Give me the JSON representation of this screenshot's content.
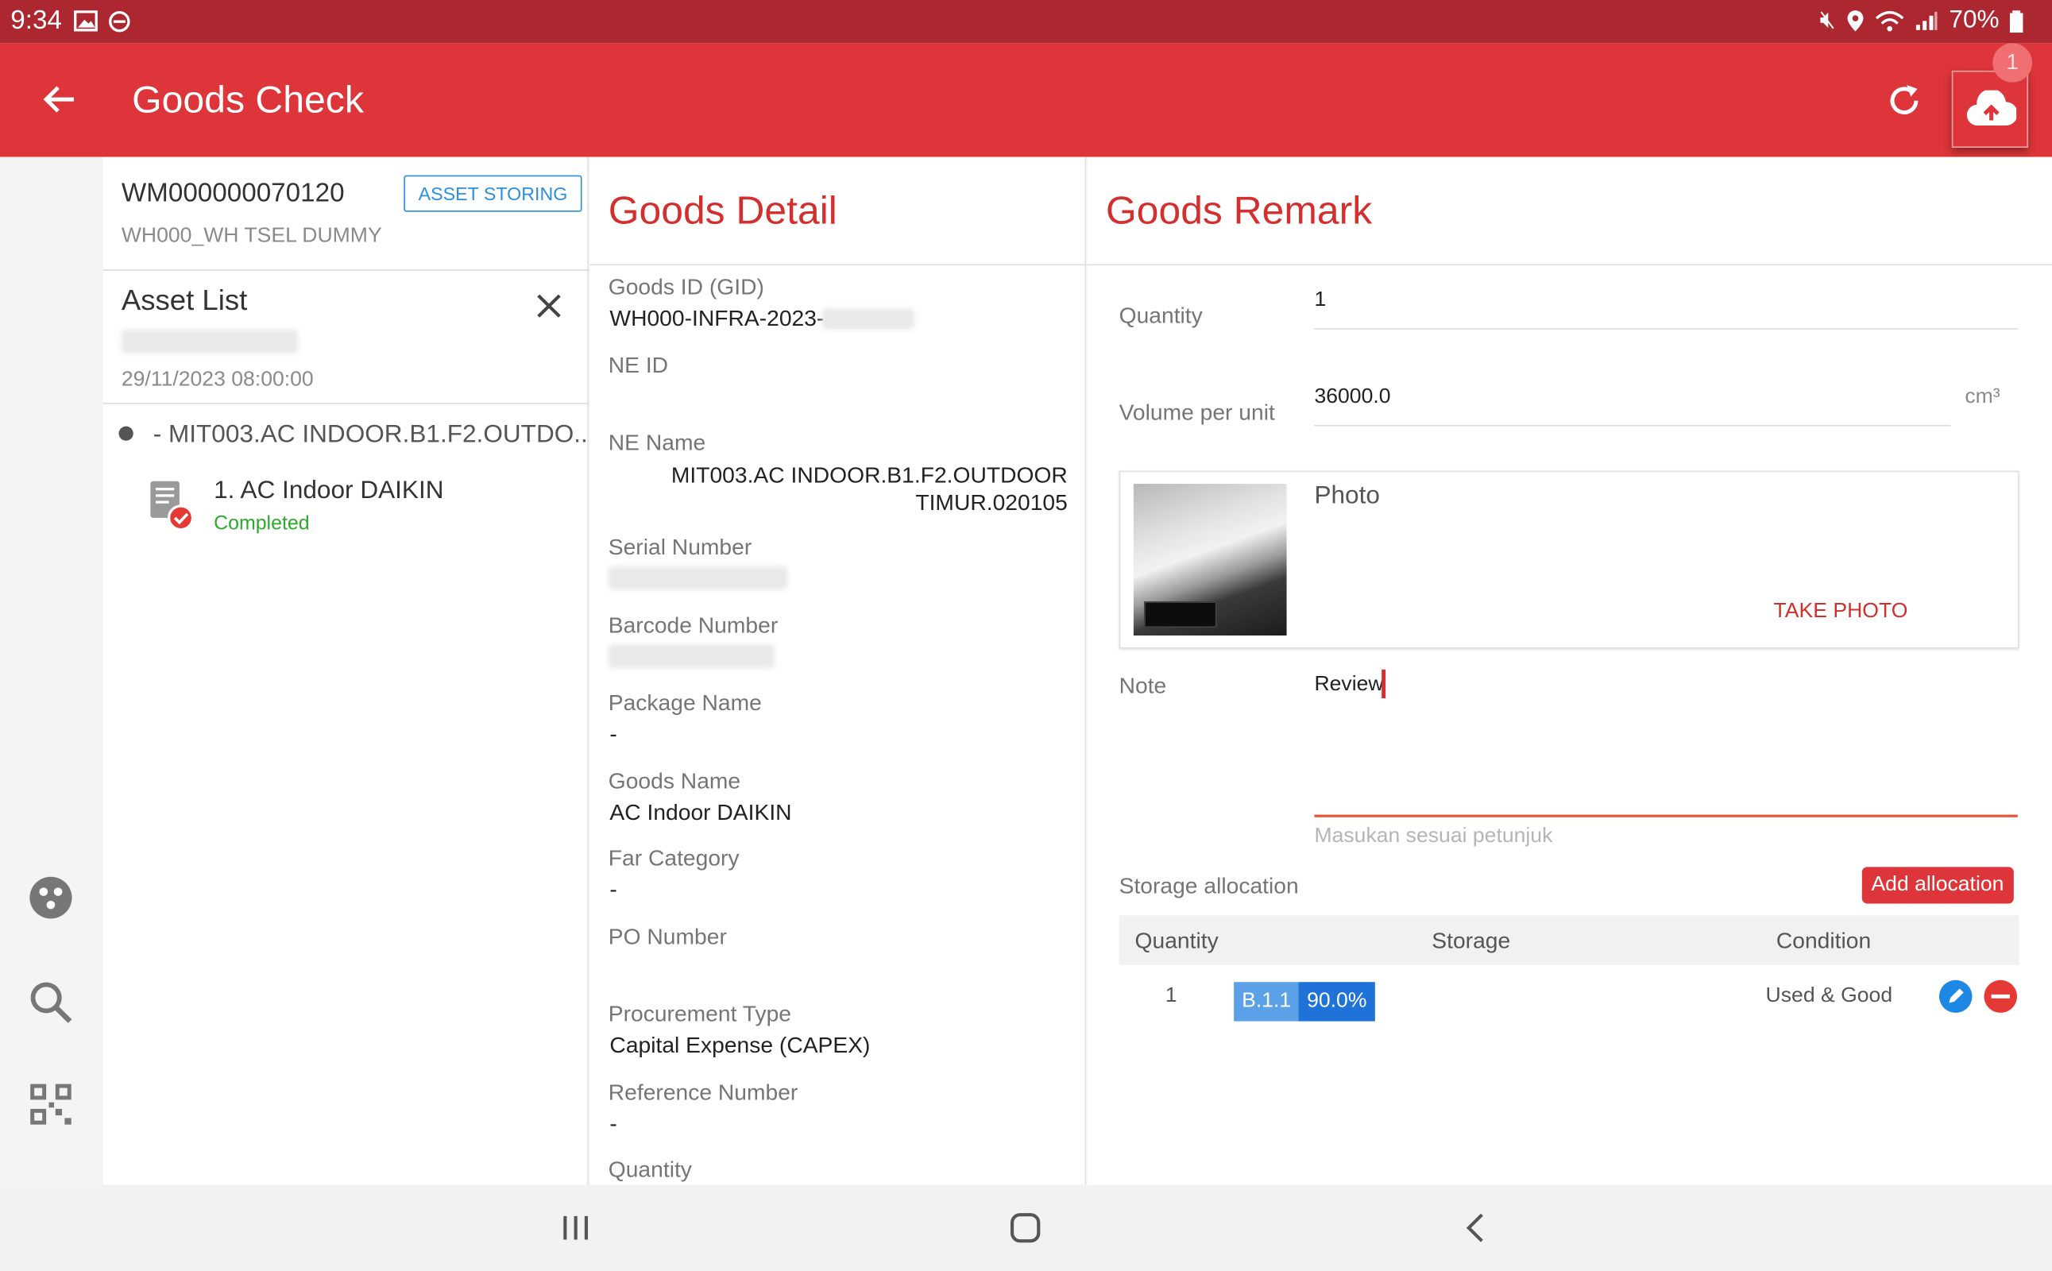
{
  "status_bar": {
    "time": "9:34",
    "battery": "70%"
  },
  "app_bar": {
    "title": "Goods Check",
    "upload_count": "1"
  },
  "order": {
    "id": "WM000000070120",
    "tag": "ASSET STORING",
    "warehouse": "WH000_WH TSEL DUMMY"
  },
  "asset_list": {
    "title": "Asset List",
    "date": "29/11/2023 08:00:00",
    "group": "- MIT003.AC INDOOR.B1.F2.OUTDO...",
    "items": [
      {
        "name": "1. AC Indoor DAIKIN",
        "status": "Completed"
      }
    ]
  },
  "goods_detail": {
    "title": "Goods Detail",
    "fields": [
      {
        "label": "Goods ID (GID)",
        "value": "WH000-INFRA-2023-"
      },
      {
        "label": "NE ID",
        "value": ""
      },
      {
        "label": "NE Name",
        "value": "MIT003.AC INDOOR.B1.F2.OUTDOOR TIMUR.020105"
      },
      {
        "label": "Serial Number",
        "value": ""
      },
      {
        "label": "Barcode Number",
        "value": ""
      },
      {
        "label": "Package Name",
        "value": "-"
      },
      {
        "label": "Goods Name",
        "value": "AC Indoor DAIKIN"
      },
      {
        "label": "Far Category",
        "value": "-"
      },
      {
        "label": "PO Number",
        "value": ""
      },
      {
        "label": "Procurement Type",
        "value": "Capital Expense (CAPEX)"
      },
      {
        "label": "Reference Number",
        "value": "-"
      },
      {
        "label": "Quantity",
        "value": ""
      }
    ]
  },
  "goods_remark": {
    "title": "Goods Remark",
    "quantity_label": "Quantity",
    "quantity_value": "1",
    "volume_label": "Volume per unit",
    "volume_value": "36000.0",
    "volume_unit": "cm³",
    "photo_label": "Photo",
    "take_photo": "TAKE PHOTO",
    "note_label": "Note",
    "note_value": "Review",
    "note_hint": "Masukan sesuai petunjuk",
    "storage_label": "Storage allocation",
    "add_allocation": "Add allocation",
    "table_headers": [
      "Quantity",
      "Storage",
      "Condition"
    ],
    "rows": [
      {
        "quantity": "1",
        "storage": "B.1.1",
        "percent": "90.0%",
        "condition": "Used & Good"
      }
    ]
  },
  "icons": [
    "back-arrow-icon",
    "refresh-icon",
    "cloud-upload-icon",
    "close-icon",
    "sensor-icon",
    "search-icon",
    "qr-code-icon",
    "document-check-icon",
    "edit-icon",
    "remove-icon"
  ],
  "colors": {
    "primary": "#dd3539",
    "status_bar": "#ad2730",
    "accent_blue": "#1e88e5",
    "completed": "#2eaa2e"
  }
}
